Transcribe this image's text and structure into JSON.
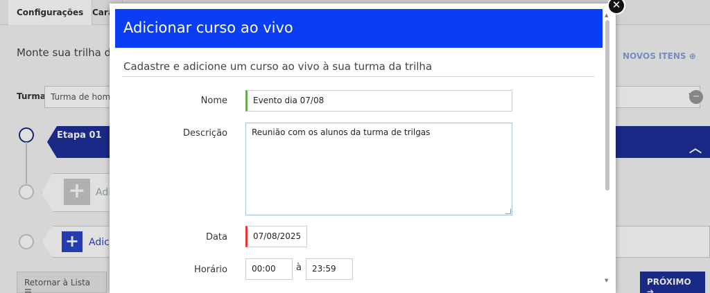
{
  "background": {
    "tabs": [
      "Configurações",
      "Cara"
    ],
    "subtitle": "Monte sua trilha de",
    "novos_itens_label": "NOVOS ITENS",
    "turma_label": "Turma",
    "turma_value": "Turma de hom",
    "stage_label": "Etapa 01",
    "add_label_1": "Adi",
    "add_label_2": "Adic",
    "retornar_label": "Retornar à Lista",
    "proximo_label": "PRÓXIMO"
  },
  "modal": {
    "title": "Adicionar curso ao vivo",
    "subtitle": "Cadastre e adicione um curso ao vivo à sua turma da trilha",
    "fields": {
      "nome_label": "Nome",
      "nome_value": "Evento dia 07/08",
      "descricao_label": "Descrição",
      "descricao_value": "Reunião com os alunos da turma de trilgas",
      "data_label": "Data",
      "data_value": "07/08/2025",
      "horario_label": "Horário",
      "horario_start": "00:00",
      "horario_sep": "à",
      "horario_end": "23:59"
    }
  },
  "colors": {
    "modal_header": "#0a3ef5",
    "stage_bar": "#1f2f99",
    "valid_border": "#6aa84f",
    "error_border": "#e53935"
  },
  "icons": [
    "close-icon",
    "chevron-up-icon",
    "plus-icon",
    "list-icon",
    "arrow-right-icon",
    "minus-circle-icon",
    "plus-circle-icon",
    "caret-down-icon"
  ]
}
